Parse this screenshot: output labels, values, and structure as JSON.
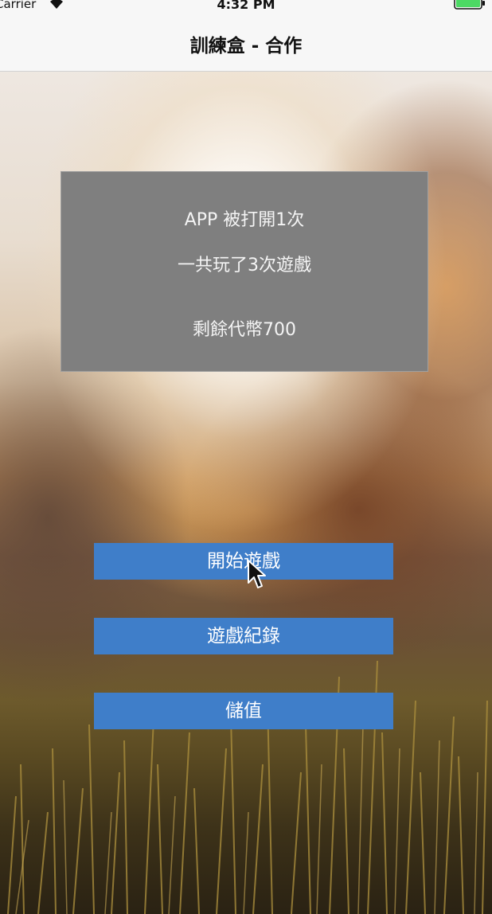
{
  "status_bar": {
    "carrier": "Carrier",
    "time": "4:32 PM",
    "wifi_icon": "wifi-icon",
    "battery_icon": "battery-icon",
    "battery_color": "#4cd964"
  },
  "nav": {
    "title": "訓練盒 - 合作"
  },
  "stats": {
    "app_opened": "APP 被打開1次",
    "games_played": "一共玩了3次遊戲",
    "coins_remaining": "剩餘代幣700"
  },
  "actions": {
    "start_game": "開始遊戲",
    "game_history": "遊戲紀錄",
    "top_up": "儲值"
  },
  "colors": {
    "button_bg": "#3f7ec9",
    "panel_bg": "#7f7f7f",
    "nav_bg": "#f7f7f7"
  }
}
